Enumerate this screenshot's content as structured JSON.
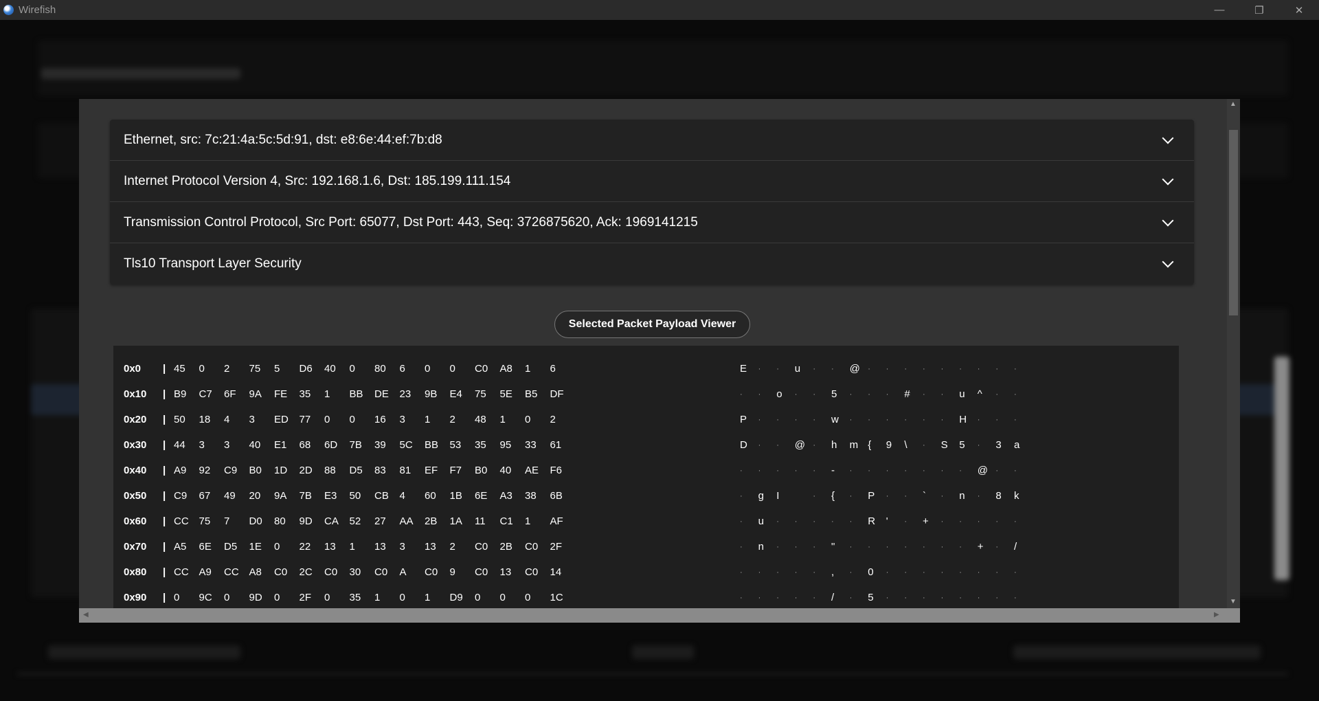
{
  "window": {
    "title": "Wirefish",
    "minimize": "—",
    "maximize": "❐",
    "close": "✕"
  },
  "accordion": [
    {
      "label": "Ethernet, src: 7c:21:4a:5c:5d:91, dst: e8:6e:44:ef:7b:d8"
    },
    {
      "label": "Internet Protocol Version 4, Src: 192.168.1.6, Dst: 185.199.111.154"
    },
    {
      "label": "Transmission Control Protocol, Src Port: 65077, Dst Port: 443, Seq: 3726875620, Ack: 1969141215"
    },
    {
      "label": "Tls10 Transport Layer Security"
    }
  ],
  "payload_button": "Selected Packet Payload Viewer",
  "hex_rows": [
    {
      "offset": "0x0",
      "bytes": [
        "45",
        "0",
        "2",
        "75",
        "5",
        "D6",
        "40",
        "0",
        "80",
        "6",
        "0",
        "0",
        "C0",
        "A8",
        "1",
        "6"
      ],
      "ascii": [
        "E",
        "·",
        "·",
        "u",
        "·",
        "·",
        "@",
        "·",
        "·",
        "·",
        "·",
        "·",
        "·",
        "·",
        "·",
        "·"
      ]
    },
    {
      "offset": "0x10",
      "bytes": [
        "B9",
        "C7",
        "6F",
        "9A",
        "FE",
        "35",
        "1",
        "BB",
        "DE",
        "23",
        "9B",
        "E4",
        "75",
        "5E",
        "B5",
        "DF"
      ],
      "ascii": [
        "·",
        "·",
        "o",
        "·",
        "·",
        "5",
        "·",
        "·",
        "·",
        "#",
        "·",
        "·",
        "u",
        "^",
        "·",
        "·"
      ]
    },
    {
      "offset": "0x20",
      "bytes": [
        "50",
        "18",
        "4",
        "3",
        "ED",
        "77",
        "0",
        "0",
        "16",
        "3",
        "1",
        "2",
        "48",
        "1",
        "0",
        "2"
      ],
      "ascii": [
        "P",
        "·",
        "·",
        "·",
        "·",
        "w",
        "·",
        "·",
        "·",
        "·",
        "·",
        "·",
        "H",
        "·",
        "·",
        "·"
      ]
    },
    {
      "offset": "0x30",
      "bytes": [
        "44",
        "3",
        "3",
        "40",
        "E1",
        "68",
        "6D",
        "7B",
        "39",
        "5C",
        "BB",
        "53",
        "35",
        "95",
        "33",
        "61"
      ],
      "ascii": [
        "D",
        "·",
        "·",
        "@",
        "·",
        "h",
        "m",
        "{",
        "9",
        "\\",
        "·",
        "S",
        "5",
        "·",
        "3",
        "a"
      ]
    },
    {
      "offset": "0x40",
      "bytes": [
        "A9",
        "92",
        "C9",
        "B0",
        "1D",
        "2D",
        "88",
        "D5",
        "83",
        "81",
        "EF",
        "F7",
        "B0",
        "40",
        "AE",
        "F6"
      ],
      "ascii": [
        "·",
        "·",
        "·",
        "·",
        "·",
        "-",
        "·",
        "·",
        "·",
        "·",
        "·",
        "·",
        "·",
        "@",
        "·",
        "·"
      ]
    },
    {
      "offset": "0x50",
      "bytes": [
        "C9",
        "67",
        "49",
        "20",
        "9A",
        "7B",
        "E3",
        "50",
        "CB",
        "4",
        "60",
        "1B",
        "6E",
        "A3",
        "38",
        "6B"
      ],
      "ascii": [
        "·",
        "g",
        "I",
        " ",
        "·",
        "{",
        "·",
        "P",
        "·",
        "·",
        "`",
        "·",
        "n",
        "·",
        "8",
        "k"
      ]
    },
    {
      "offset": "0x60",
      "bytes": [
        "CC",
        "75",
        "7",
        "D0",
        "80",
        "9D",
        "CA",
        "52",
        "27",
        "AA",
        "2B",
        "1A",
        "11",
        "C1",
        "1",
        "AF"
      ],
      "ascii": [
        "·",
        "u",
        "·",
        "·",
        "·",
        "·",
        "·",
        "R",
        "'",
        "·",
        "+",
        "·",
        "·",
        "·",
        "·",
        "·"
      ]
    },
    {
      "offset": "0x70",
      "bytes": [
        "A5",
        "6E",
        "D5",
        "1E",
        "0",
        "22",
        "13",
        "1",
        "13",
        "3",
        "13",
        "2",
        "C0",
        "2B",
        "C0",
        "2F"
      ],
      "ascii": [
        "·",
        "n",
        "·",
        "·",
        "·",
        "\"",
        "·",
        "·",
        "·",
        "·",
        "·",
        "·",
        "·",
        "+",
        "·",
        "/"
      ]
    },
    {
      "offset": "0x80",
      "bytes": [
        "CC",
        "A9",
        "CC",
        "A8",
        "C0",
        "2C",
        "C0",
        "30",
        "C0",
        "A",
        "C0",
        "9",
        "C0",
        "13",
        "C0",
        "14"
      ],
      "ascii": [
        "·",
        "·",
        "·",
        "·",
        "·",
        ",",
        "·",
        "0",
        "·",
        "·",
        "·",
        "·",
        "·",
        "·",
        "·",
        "·"
      ]
    },
    {
      "offset": "0x90",
      "bytes": [
        "0",
        "9C",
        "0",
        "9D",
        "0",
        "2F",
        "0",
        "35",
        "1",
        "0",
        "1",
        "D9",
        "0",
        "0",
        "0",
        "1C"
      ],
      "ascii": [
        "·",
        "·",
        "·",
        "·",
        "·",
        "/",
        "·",
        "5",
        "·",
        "·",
        "·",
        "·",
        "·",
        "·",
        "·",
        "·"
      ]
    }
  ]
}
